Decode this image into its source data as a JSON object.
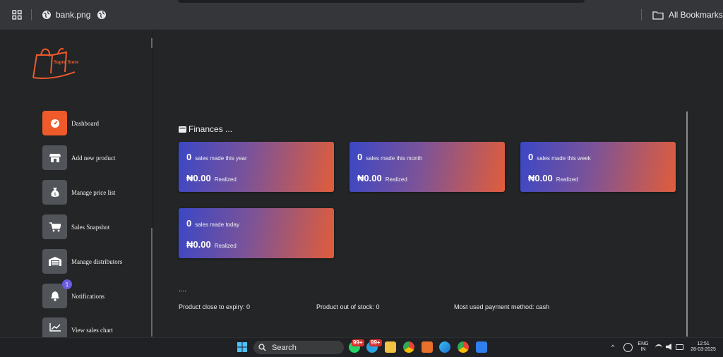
{
  "browser": {
    "tab_title": "bank.png",
    "bookmarks_label": "All Bookmarks"
  },
  "brand": {
    "logo_text": "Super Store",
    "accent": "#ef5a2b"
  },
  "sidebar": {
    "items": [
      {
        "label": "Dashboard",
        "icon": "dashboard-gauge-icon",
        "active": true
      },
      {
        "label": "Add new product",
        "icon": "store-icon"
      },
      {
        "label": "Manage price list",
        "icon": "money-bag-icon"
      },
      {
        "label": "Sales Snapshot",
        "icon": "cart-icon"
      },
      {
        "label": "Manage distributors",
        "icon": "warehouse-icon"
      },
      {
        "label": "Notifications",
        "icon": "bell-icon",
        "badge": "1"
      },
      {
        "label": "View sales chart",
        "icon": "line-chart-icon"
      }
    ]
  },
  "finances": {
    "title": "Finances ...",
    "cards": [
      {
        "count": "0",
        "label": "sales made this year",
        "amount": "₦0.00",
        "status": "Realized"
      },
      {
        "count": "0",
        "label": "sales made this month",
        "amount": "₦0.00",
        "status": "Realized"
      },
      {
        "count": "0",
        "label": "sales made this week",
        "amount": "₦0.00",
        "status": "Realized"
      },
      {
        "count": "0",
        "label": "sales made today",
        "amount": "₦0.00",
        "status": "Realized"
      }
    ]
  },
  "summary": {
    "dots": "....",
    "expiry": "Product close to expiry: 0",
    "out_of_stock": "Product out of stock: 0",
    "payment": "Most used payment method: cash"
  },
  "taskbar": {
    "search_label": "Search",
    "whatsapp_badge": "99+",
    "telegram_badge": "99+",
    "lang_top": "ENG",
    "lang_bottom": "IN",
    "time": "12:51",
    "date": "28-03-2025"
  }
}
